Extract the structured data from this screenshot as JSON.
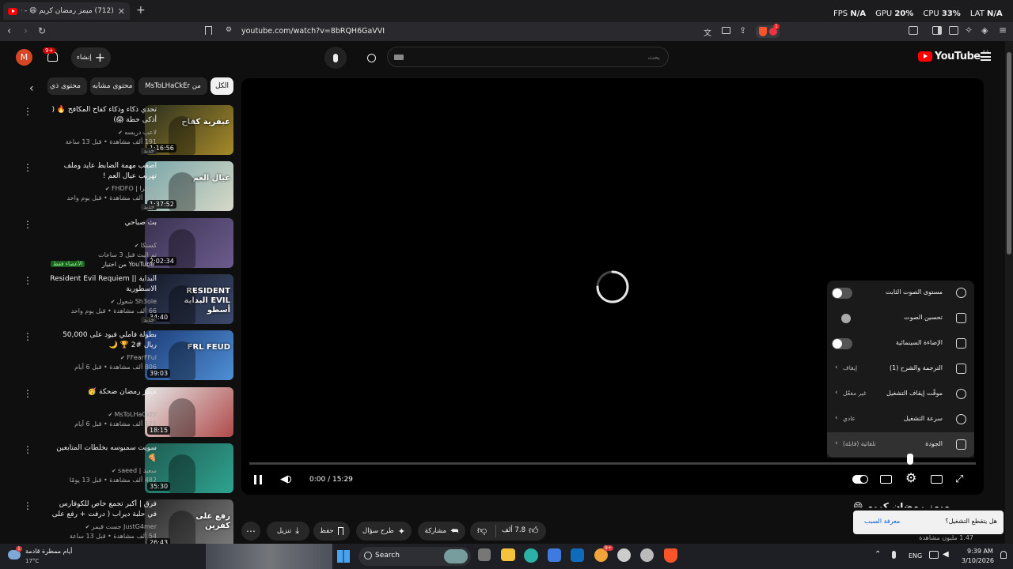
{
  "browser": {
    "tab_title": "(712) ميمز رمضان كريم 😄 - YouTube",
    "tab_add": "+",
    "url": "youtube.com/watch?v=8bRQH6GaVVI",
    "overlay": [
      {
        "label": "FPS",
        "value": "N/A"
      },
      {
        "label": "GPU",
        "value": "20",
        "unit": "%"
      },
      {
        "label": "CPU",
        "value": "33",
        "unit": "%"
      },
      {
        "label": "LAT",
        "value": "N/A"
      }
    ],
    "brave_badge": "1"
  },
  "header": {
    "logo_text": "YouTube",
    "country": "SA",
    "search_placeholder": "بحث",
    "create_label": "إنشاء",
    "notif_count": "9+",
    "avatar_letter": "M"
  },
  "chips": [
    "الكل",
    "من MsToLHaCkEr",
    "محتوى مشابه",
    "محتوى ذي صلة"
  ],
  "up_next": [
    {
      "title": "تحدي ذكاء وذكاء كفاح المكافح 🔥 ( أذكى خطة 😱)",
      "channel": "لاعب دريسه",
      "views": "191 ألف مشاهدة • قبل 13 ساعة",
      "badge": "جديد",
      "duration": "1:16:56",
      "thumb_text": "عبقرية كفاح",
      "c1": "#2b2f1d",
      "c2": "#a68a2a"
    },
    {
      "title": "اصعب مهمة الضابط عايد وملف تهريب عيال العم !",
      "channel": "ابو فرا | FHDFO",
      "views": "230 ألف مشاهدة • قبل يوم واحد",
      "badge": "جديد",
      "duration": "1:37:52",
      "thumb_text": "عيال العم",
      "c1": "#7aa6a8",
      "c2": "#d7d9c8"
    },
    {
      "title": "بث صباحي",
      "channel": "كسنكا",
      "views": "تم البث قبل 3 ساعات",
      "badge": "من اختيار YouTube",
      "badge2": "الأعضاء فقط",
      "duration": "2:02:34",
      "thumb_text": "",
      "c1": "#3a3250",
      "c2": "#6c5b8e"
    },
    {
      "title": "البداية || Resident Evil Requiem الاسطورية",
      "channel": "Sh3ole شعول",
      "views": "66 ألف مشاهدة • قبل يوم واحد",
      "badge": "جديد",
      "duration": "34:40",
      "thumb_text": "RESIDENT EVIL البداية أسطو",
      "c1": "#161b2a",
      "c2": "#3c4a6b"
    },
    {
      "title": "بطولة فاملي فيود على 50,000 ريال #2 🏆 🌙",
      "channel": "FFearFFul",
      "views": "806 ألف مشاهدة • قبل 6 أيام",
      "badge": "",
      "duration": "39:03",
      "thumb_text": "FRL FEUD",
      "c1": "#1d3d78",
      "c2": "#4f8fd6"
    },
    {
      "title": "ميمز رمضان ضحكة 🥳",
      "channel": "MsToLHaCkEr",
      "views": "171 ألف مشاهدة • قبل 6 أيام",
      "badge": "",
      "duration": "18:15",
      "thumb_text": "",
      "c1": "#e6e6e6",
      "c2": "#b04a4a"
    },
    {
      "title": "سويت سمبوسه بخلطات المتابعين 🍕",
      "channel": "سعيد | saeed",
      "views": "482 ألف مشاهدة • قبل 13 يومًا",
      "badge": "",
      "duration": "35:30",
      "thumb_text": "",
      "c1": "#1f5b52",
      "c2": "#2fa38f"
    },
    {
      "title": "فرق | أكبر تجمع خاص للكوفارس في حلبة ديراب ( درفت + رفع على كفرين )",
      "channel": "JustG4mer جست قيمر",
      "views": "54 ألف مشاهدة • قبل 13 ساعة",
      "badge": "",
      "duration": "26:43",
      "thumb_text": "رفع على كفرين",
      "c1": "#2a2a2a",
      "c2": "#7d7d7d"
    }
  ],
  "player": {
    "time": "0:00 / 15:29",
    "progress": 0.0,
    "settings": [
      {
        "label": "مستوى الصوت الثابت",
        "type": "toggle",
        "on": false,
        "icon": "stable-volume-icon"
      },
      {
        "label": "تحسين الصوت",
        "type": "dot",
        "icon": "voice-boost-icon"
      },
      {
        "label": "الإضاءة السينمائية",
        "type": "toggle",
        "on": false,
        "icon": "ambient-mode-icon"
      },
      {
        "label": "الترجمة والشرح (1)",
        "type": "value",
        "value": "إيقاف",
        "icon": "subtitles-icon"
      },
      {
        "label": "موقّت إيقاف التشغيل",
        "type": "value",
        "value": "غير مفعّل",
        "icon": "sleep-timer-icon"
      },
      {
        "label": "سرعة التشغيل",
        "type": "value",
        "value": "عادي",
        "icon": "speed-icon"
      },
      {
        "label": "الجودة",
        "type": "value",
        "value": "تلقائية (قابلة)",
        "icon": "quality-icon"
      }
    ]
  },
  "below": {
    "title_partial": "ميمز رمضان كريم 😄",
    "views_partial": "1.47 مليون مشاهدة",
    "likes": "7.8 ألف",
    "share": "مشاركة",
    "ask": "طرح سؤال",
    "save": "حفظ",
    "download": "تنزيل"
  },
  "toast": {
    "question": "هل يتقطع التشغيل؟",
    "link": "معرفة السبب"
  },
  "taskbar": {
    "weather_text": "أيام ممطرة قادمة",
    "temp": "17°C",
    "weather_badge": "1",
    "search_label": "Search",
    "lang": "ENG",
    "time": "9:39 AM",
    "date": "3/10/2026",
    "store_badge": "9+"
  },
  "colors": {
    "accent": "#ff0000",
    "toast_link": "#3ea6ff",
    "bg": "#0f0f0f"
  }
}
